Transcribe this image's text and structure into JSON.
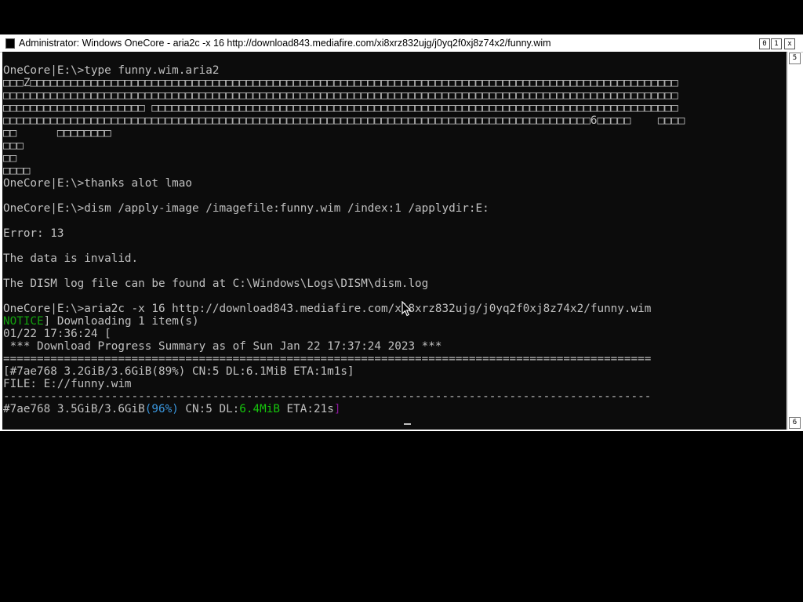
{
  "window": {
    "title": "Administrator:  Windows OneCore - aria2c  -x 16 http://download843.mediafire.com/xi8xrz832ujg/j0yq2f0xj8z74x2/funny.wim",
    "btn_min": "0",
    "btn_max": "1",
    "btn_close": "x",
    "scroll_up": "5",
    "scroll_down": "6"
  },
  "console": {
    "lines": [
      "OneCore|E:\\>type funny.wim.aria2",
      "□□□Z□□□□□□□□□□□□□□□□□□□□□□□□□□□□□□□□□□□□□□□□□□□□□□□□□□□□□□□□□□□□□□□□□□□□□□□□□□□□□□□□□□□□□□□□□□□□□□□□",
      "□□□□□□□□□□□□□□□□□□□□□□□□□□□□□□□□□□□□□□□□□□□□□□□□□□□□□□□□□□□□□□□□□□□□□□□□□□□□□□□□□□□□□□□□□□□□□□□□□□□□",
      "□□□□□□□□□□□□□□□□□□□□□ □□□□□□□□□□□□□□□□□□□□□□□□□□□□□□□□□□□□□□□□□□□□□□□□□□□□□□□□□□□□□□□□□□□□□□□□□□□□□□",
      "□□□□□□□□□□□□□□□□□□□□□□□□□□□□□□□□□□□□□□□□□□□□□□□□□□□□□□□□□□□□□□□□□□□□□□□□□□□□□□□□□□□□□□□6□□□□□    □□□□",
      "□□      □□□□□□□□",
      "□□□",
      "□□",
      "□□□□",
      "OneCore|E:\\>thanks alot lmao",
      "",
      "OneCore|E:\\>dism /apply-image /imagefile:funny.wim /index:1 /applydir:E:",
      "",
      "Error: 13",
      "",
      "The data is invalid.",
      "",
      "The DISM log file can be found at C:\\Windows\\Logs\\DISM\\dism.log",
      "",
      "OneCore|E:\\>aria2c -x 16 http://download843.mediafire.com/xi8xrz832ujg/j0yq2f0xj8z74x2/funny.wim",
      "",
      "01/22 17:36:24 [",
      " *** Download Progress Summary as of Sun Jan 22 17:37:24 2023 ***",
      "================================================================================================",
      "[#7ae768 3.2GiB/3.6GiB(89%) CN:5 DL:6.1MiB ETA:1m1s]",
      "FILE: E://funny.wim",
      "------------------------------------------------------------------------------------------------",
      "",
      "["
    ],
    "notice_tag": "NOTICE",
    "notice_rest": "] Downloading 1 item(s)",
    "progress": {
      "gid_sizes": "#7ae768 3.5GiB/3.6GiB",
      "percent": "(96%)",
      "cn": " CN:5 DL:",
      "speed": "6.4MiB",
      "eta": " ETA:21s",
      "close": "]"
    }
  }
}
